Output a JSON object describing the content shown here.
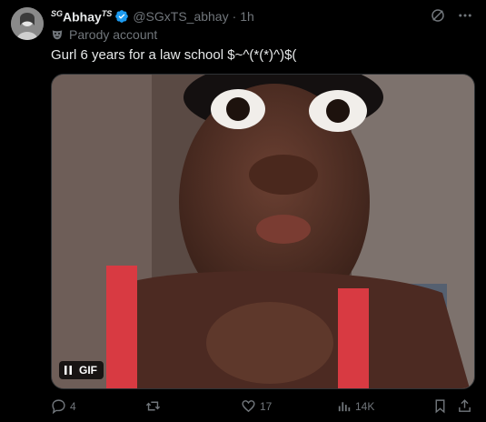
{
  "author": {
    "display_name": "Abhay",
    "name_prefix": "SG",
    "name_suffix": "TS",
    "handle": "@SGxTS_abhay",
    "separator": "·",
    "time": "1h",
    "label": "Parody account"
  },
  "tweet": {
    "text": "Gurl 6 years for a law school $~^(*(*)^)$("
  },
  "media": {
    "type_label": "GIF"
  },
  "actions": {
    "replies": "4",
    "likes": "17",
    "views": "14K"
  },
  "colors": {
    "background": "#000000",
    "text": "#e7e9ea",
    "muted": "#71767b",
    "verified_blue": "#1d9bf0"
  },
  "icons": [
    "verified-badge-icon",
    "grok-icon",
    "more-icon",
    "parody-mask-icon",
    "pause-icon",
    "reply-icon",
    "retweet-icon",
    "like-icon",
    "views-icon",
    "bookmark-icon",
    "share-icon"
  ]
}
